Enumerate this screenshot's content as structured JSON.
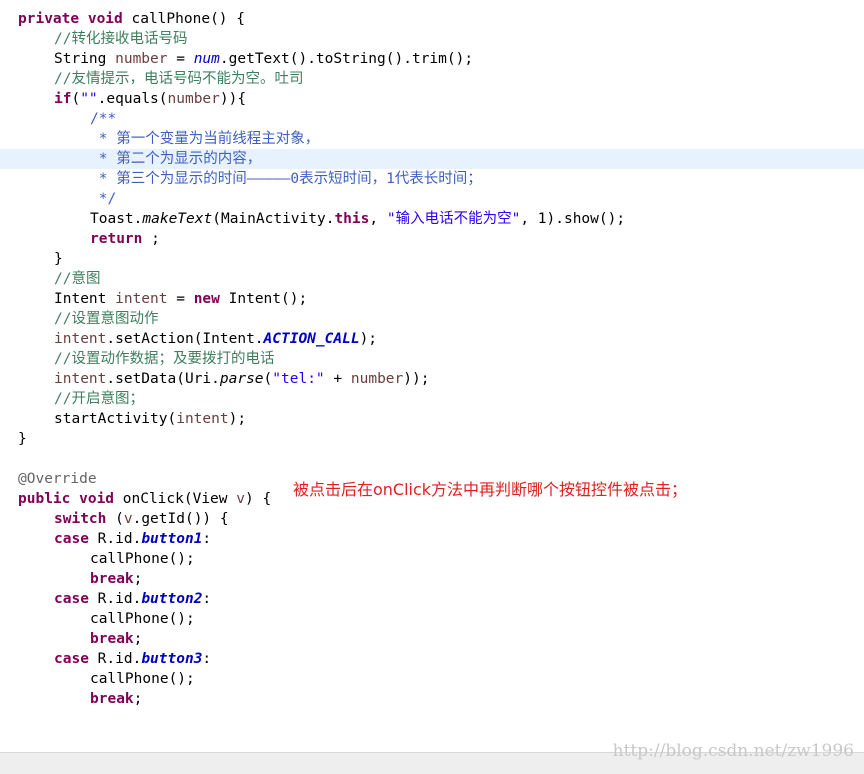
{
  "editor": {
    "current_line_index": 7,
    "lines": [
      {
        "indent": 0,
        "tokens": [
          {
            "t": "private void",
            "c": "kw"
          },
          {
            "t": " callPhone() {",
            "c": "pl"
          }
        ]
      },
      {
        "indent": 1,
        "tokens": [
          {
            "t": "//转化接收电话号码",
            "c": "cm"
          }
        ]
      },
      {
        "indent": 1,
        "tokens": [
          {
            "t": "String ",
            "c": "pl"
          },
          {
            "t": "number",
            "c": "var"
          },
          {
            "t": " = ",
            "c": "pl"
          },
          {
            "t": "num",
            "c": "sfld"
          },
          {
            "t": ".getText().toString().trim();",
            "c": "pl"
          }
        ]
      },
      {
        "indent": 1,
        "tokens": [
          {
            "t": "//友情提示，电话号码不能为空。吐司",
            "c": "cm"
          }
        ]
      },
      {
        "indent": 1,
        "tokens": [
          {
            "t": "if",
            "c": "kw"
          },
          {
            "t": "(",
            "c": "pl"
          },
          {
            "t": "\"\"",
            "c": "str"
          },
          {
            "t": ".equals(",
            "c": "pl"
          },
          {
            "t": "number",
            "c": "var"
          },
          {
            "t": ")){",
            "c": "pl"
          }
        ]
      },
      {
        "indent": 2,
        "tokens": [
          {
            "t": "/**",
            "c": "doc"
          }
        ]
      },
      {
        "indent": 2,
        "tokens": [
          {
            "t": " * 第一个变量为当前线程主对象，",
            "c": "doc"
          }
        ]
      },
      {
        "indent": 2,
        "tokens": [
          {
            "t": " * 第二个为显示的内容，",
            "c": "doc"
          }
        ]
      },
      {
        "indent": 2,
        "tokens": [
          {
            "t": " * 第三个为显示的时间—————0表示短时间，1代表长时间；",
            "c": "doc"
          }
        ]
      },
      {
        "indent": 2,
        "tokens": [
          {
            "t": " */",
            "c": "doc"
          }
        ]
      },
      {
        "indent": 2,
        "tokens": [
          {
            "t": "Toast.",
            "c": "pl"
          },
          {
            "t": "makeText",
            "c": "it"
          },
          {
            "t": "(MainActivity.",
            "c": "pl"
          },
          {
            "t": "this",
            "c": "kw"
          },
          {
            "t": ", ",
            "c": "pl"
          },
          {
            "t": "\"输入电话不能为空\"",
            "c": "str"
          },
          {
            "t": ", 1).show();",
            "c": "pl"
          }
        ]
      },
      {
        "indent": 2,
        "tokens": [
          {
            "t": "return",
            "c": "kw"
          },
          {
            "t": " ;",
            "c": "pl"
          }
        ]
      },
      {
        "indent": 1,
        "tokens": [
          {
            "t": "}",
            "c": "pl"
          }
        ]
      },
      {
        "indent": 1,
        "tokens": [
          {
            "t": "//意图",
            "c": "cm"
          }
        ]
      },
      {
        "indent": 1,
        "tokens": [
          {
            "t": "Intent ",
            "c": "pl"
          },
          {
            "t": "intent",
            "c": "var"
          },
          {
            "t": " = ",
            "c": "pl"
          },
          {
            "t": "new",
            "c": "kw"
          },
          {
            "t": " Intent();",
            "c": "pl"
          }
        ]
      },
      {
        "indent": 1,
        "tokens": [
          {
            "t": "//设置意图动作",
            "c": "cm"
          }
        ]
      },
      {
        "indent": 1,
        "tokens": [
          {
            "t": "intent",
            "c": "var"
          },
          {
            "t": ".setAction(Intent.",
            "c": "pl"
          },
          {
            "t": "ACTION_CALL",
            "c": "fld"
          },
          {
            "t": ");",
            "c": "pl"
          }
        ]
      },
      {
        "indent": 1,
        "tokens": [
          {
            "t": "//设置动作数据；及要拨打的电话",
            "c": "cm"
          }
        ]
      },
      {
        "indent": 1,
        "tokens": [
          {
            "t": "intent",
            "c": "var"
          },
          {
            "t": ".setData(Uri.",
            "c": "pl"
          },
          {
            "t": "parse",
            "c": "it"
          },
          {
            "t": "(",
            "c": "pl"
          },
          {
            "t": "\"tel:\"",
            "c": "str"
          },
          {
            "t": " + ",
            "c": "pl"
          },
          {
            "t": "number",
            "c": "var"
          },
          {
            "t": "));",
            "c": "pl"
          }
        ]
      },
      {
        "indent": 1,
        "tokens": [
          {
            "t": "//开启意图；",
            "c": "cm"
          }
        ]
      },
      {
        "indent": 1,
        "tokens": [
          {
            "t": "startActivity(",
            "c": "pl"
          },
          {
            "t": "intent",
            "c": "var"
          },
          {
            "t": ");",
            "c": "pl"
          }
        ]
      },
      {
        "indent": 0,
        "tokens": [
          {
            "t": "}",
            "c": "pl"
          }
        ]
      },
      {
        "indent": 0,
        "tokens": []
      },
      {
        "indent": 0,
        "tokens": [
          {
            "t": "@Override",
            "c": "ann"
          }
        ]
      },
      {
        "indent": 0,
        "tokens": [
          {
            "t": "public void",
            "c": "kw"
          },
          {
            "t": " onClick(View ",
            "c": "pl"
          },
          {
            "t": "v",
            "c": "var"
          },
          {
            "t": ") {",
            "c": "pl"
          }
        ]
      },
      {
        "indent": 1,
        "tokens": [
          {
            "t": "switch",
            "c": "kw"
          },
          {
            "t": " (",
            "c": "pl"
          },
          {
            "t": "v",
            "c": "var"
          },
          {
            "t": ".getId()) {",
            "c": "pl"
          }
        ]
      },
      {
        "indent": 1,
        "tokens": [
          {
            "t": "case",
            "c": "kw"
          },
          {
            "t": " R.id.",
            "c": "pl"
          },
          {
            "t": "button1",
            "c": "fld"
          },
          {
            "t": ":",
            "c": "pl"
          }
        ]
      },
      {
        "indent": 2,
        "tokens": [
          {
            "t": "callPhone();",
            "c": "pl"
          }
        ]
      },
      {
        "indent": 2,
        "tokens": [
          {
            "t": "break",
            "c": "kw"
          },
          {
            "t": ";",
            "c": "pl"
          }
        ]
      },
      {
        "indent": 1,
        "tokens": [
          {
            "t": "case",
            "c": "kw"
          },
          {
            "t": " R.id.",
            "c": "pl"
          },
          {
            "t": "button2",
            "c": "fld"
          },
          {
            "t": ":",
            "c": "pl"
          }
        ]
      },
      {
        "indent": 2,
        "tokens": [
          {
            "t": "callPhone();",
            "c": "pl"
          }
        ]
      },
      {
        "indent": 2,
        "tokens": [
          {
            "t": "break",
            "c": "kw"
          },
          {
            "t": ";",
            "c": "pl"
          }
        ]
      },
      {
        "indent": 1,
        "tokens": [
          {
            "t": "case",
            "c": "kw"
          },
          {
            "t": " R.id.",
            "c": "pl"
          },
          {
            "t": "button3",
            "c": "fld"
          },
          {
            "t": ":",
            "c": "pl"
          }
        ]
      },
      {
        "indent": 2,
        "tokens": [
          {
            "t": "callPhone();",
            "c": "pl"
          }
        ]
      },
      {
        "indent": 2,
        "tokens": [
          {
            "t": "break",
            "c": "kw"
          },
          {
            "t": ";",
            "c": "pl"
          }
        ]
      }
    ]
  },
  "annotation": {
    "text": "被点击后在onClick方法中再判断哪个按钮控件被点击；",
    "color": "#e02020"
  },
  "watermark": {
    "text": "http://blog.csdn.net/zw1996"
  },
  "colors": {
    "keyword": "#7f0055",
    "comment": "#3f7f5f",
    "javadoc": "#3f5fbf",
    "string": "#2a00ff",
    "local_variable": "#6a3e3e",
    "field": "#0000c0",
    "current_line_highlight": "#e8f2fe"
  }
}
